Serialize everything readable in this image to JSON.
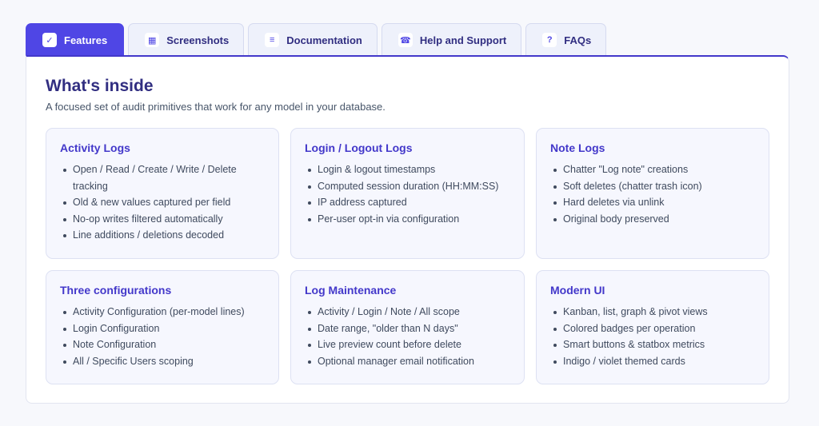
{
  "tabs": [
    {
      "label": "Features",
      "icon": "check-icon",
      "glyph": "✓",
      "active": true
    },
    {
      "label": "Screenshots",
      "icon": "image-icon",
      "glyph": "▦",
      "active": false
    },
    {
      "label": "Documentation",
      "icon": "document-icon",
      "glyph": "≡",
      "active": false
    },
    {
      "label": "Help and Support",
      "icon": "phone-icon",
      "glyph": "☎",
      "active": false
    },
    {
      "label": "FAQs",
      "icon": "question-icon",
      "glyph": "?",
      "active": false
    }
  ],
  "panel": {
    "title": "What's inside",
    "subtitle": "A focused set of audit primitives that work for any model in your database."
  },
  "cards": [
    {
      "title": "Activity Logs",
      "items": [
        "Open / Read / Create / Write / Delete tracking",
        "Old & new values captured per field",
        "No-op writes filtered automatically",
        "Line additions / deletions decoded"
      ]
    },
    {
      "title": "Login / Logout Logs",
      "items": [
        "Login & logout timestamps",
        "Computed session duration (HH:MM:SS)",
        "IP address captured",
        "Per-user opt-in via configuration"
      ]
    },
    {
      "title": "Note Logs",
      "items": [
        "Chatter \"Log note\" creations",
        "Soft deletes (chatter trash icon)",
        "Hard deletes via unlink",
        "Original body preserved"
      ]
    },
    {
      "title": "Three configurations",
      "items": [
        "Activity Configuration (per-model lines)",
        "Login Configuration",
        "Note Configuration",
        "All / Specific Users scoping"
      ]
    },
    {
      "title": "Log Maintenance",
      "items": [
        "Activity / Login / Note / All scope",
        "Date range, \"older than N days\"",
        "Live preview count before delete",
        "Optional manager email notification"
      ]
    },
    {
      "title": "Modern UI",
      "items": [
        "Kanban, list, graph & pivot views",
        "Colored badges per operation",
        "Smart buttons & statbox metrics",
        "Indigo / violet themed cards"
      ]
    }
  ],
  "colors": {
    "accent": "#4f46e5",
    "title": "#312e81",
    "card_bg": "#f6f7fe"
  }
}
